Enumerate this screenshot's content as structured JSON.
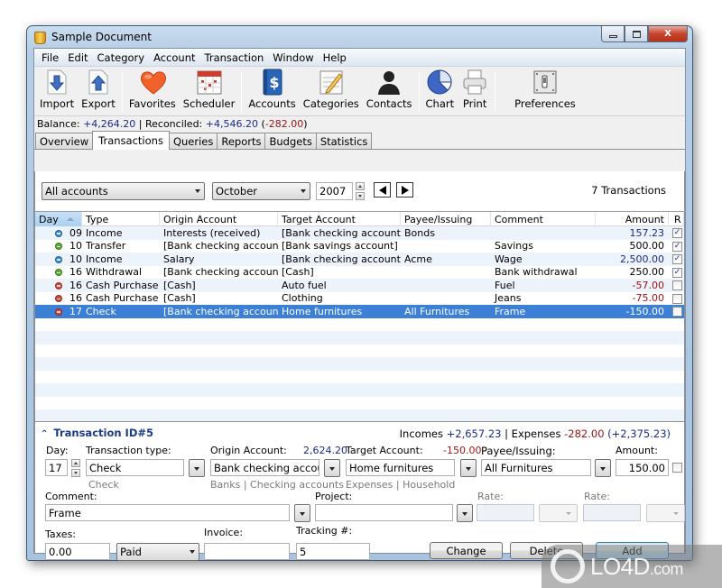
{
  "window": {
    "title": "Sample Document",
    "controls": {
      "minimize": "—",
      "maximize": "□",
      "close": "X"
    }
  },
  "menu": [
    "File",
    "Edit",
    "Category",
    "Account",
    "Transaction",
    "Window",
    "Help"
  ],
  "toolbar": {
    "groups": [
      [
        {
          "label": "Import",
          "icon": "import-icon"
        },
        {
          "label": "Export",
          "icon": "export-icon"
        }
      ],
      [
        {
          "label": "Favorites",
          "icon": "heart-icon"
        },
        {
          "label": "Scheduler",
          "icon": "calendar-icon"
        }
      ],
      [
        {
          "label": "Accounts",
          "icon": "accounts-book-icon"
        },
        {
          "label": "Categories",
          "icon": "categories-icon"
        },
        {
          "label": "Contacts",
          "icon": "contact-person-icon"
        }
      ],
      [
        {
          "label": "Chart",
          "icon": "pie-chart-icon"
        },
        {
          "label": "Print",
          "icon": "printer-icon"
        }
      ],
      [
        {
          "label": "Preferences",
          "icon": "preferences-switch-icon"
        }
      ]
    ]
  },
  "balance": {
    "balance_label": "Balance:",
    "balance_value": "+4,264.20",
    "separator": " | ",
    "reconciled_label": "Reconciled:",
    "reconciled_value": "+4,546.20",
    "difference": "-282.00"
  },
  "tabs": [
    {
      "label": "Overview",
      "active": false
    },
    {
      "label": "Transactions",
      "active": true
    },
    {
      "label": "Queries",
      "active": false
    },
    {
      "label": "Reports",
      "active": false
    },
    {
      "label": "Budgets",
      "active": false
    },
    {
      "label": "Statistics",
      "active": false
    }
  ],
  "filters": {
    "account": "All accounts",
    "month": "October",
    "year": "2007",
    "count": "7 Transactions"
  },
  "table": {
    "columns": [
      "Day",
      "Type",
      "Origin Account",
      "Target Account",
      "Payee/Issuing",
      "Comment",
      "Amount",
      "R"
    ],
    "sorted_column": "Day",
    "rows": [
      {
        "status": "blue",
        "day": "09",
        "type": "Income",
        "origin": "Interests (received)",
        "target": "[Bank checking account]",
        "payee": "Bonds",
        "comment": "",
        "amount": "157.23",
        "amount_color": "blue",
        "reconciled": true,
        "selected": false
      },
      {
        "status": "green",
        "day": "10",
        "type": "Transfer",
        "origin": "[Bank checking account]",
        "target": "[Bank savings account]",
        "payee": "",
        "comment": "Savings",
        "amount": "500.00",
        "amount_color": "black",
        "reconciled": true,
        "selected": false
      },
      {
        "status": "blue",
        "day": "10",
        "type": "Income",
        "origin": "Salary",
        "target": "[Bank checking account]",
        "payee": "Acme",
        "comment": "Wage",
        "amount": "2,500.00",
        "amount_color": "blue",
        "reconciled": true,
        "selected": false
      },
      {
        "status": "green",
        "day": "16",
        "type": "Withdrawal",
        "origin": "[Bank checking account]",
        "target": "[Cash]",
        "payee": "",
        "comment": "Bank withdrawal",
        "amount": "250.00",
        "amount_color": "black",
        "reconciled": true,
        "selected": false
      },
      {
        "status": "red",
        "day": "16",
        "type": "Cash Purchase",
        "origin": "[Cash]",
        "target": "Auto fuel",
        "payee": "",
        "comment": "Fuel",
        "amount": "-57.00",
        "amount_color": "red",
        "reconciled": false,
        "selected": false
      },
      {
        "status": "red",
        "day": "16",
        "type": "Cash Purchase",
        "origin": "[Cash]",
        "target": "Clothing",
        "payee": "",
        "comment": "Jeans",
        "amount": "-75.00",
        "amount_color": "red",
        "reconciled": false,
        "selected": false
      },
      {
        "status": "red",
        "day": "17",
        "type": "Check",
        "origin": "[Bank checking account]",
        "target": "Home furnitures",
        "payee": "All Furnitures",
        "comment": "Frame",
        "amount": "-150.00",
        "amount_color": "red",
        "reconciled": false,
        "selected": true
      }
    ]
  },
  "detail": {
    "title": "Transaction ID#5",
    "summary": {
      "incomes_label": "Incomes",
      "incomes": "+2,657.23",
      "sep": " | ",
      "expenses_label": "Expenses",
      "expenses": "-282.00",
      "net": "(+2,375.23)"
    },
    "day_label": "Day:",
    "day": "17",
    "type_label": "Transaction type:",
    "type": "Check",
    "type_hint": "Check",
    "origin_label": "Origin Account:",
    "origin_balance": "2,624.20",
    "origin": "Bank checking account",
    "origin_hint": "Banks | Checking accounts",
    "target_label": "Target Account:",
    "target_balance": "-150.00",
    "target": "Home furnitures",
    "target_hint": "Expenses | Household",
    "payee_label": "Payee/Issuing:",
    "payee": "All Furnitures",
    "amount_label": "Amount:",
    "amount": "150.00",
    "comment_label": "Comment:",
    "comment": "Frame",
    "project_label": "Project:",
    "project": "",
    "rate1_label": "Rate:",
    "rate2_label": "Rate:",
    "taxes_label": "Taxes:",
    "taxes": "0.00",
    "tax_status": "Paid",
    "invoice_label": "Invoice:",
    "invoice": "",
    "tracking_label": "Tracking #:",
    "tracking": "5",
    "buttons": {
      "change": "Change",
      "delete": "Delete",
      "add": "Add"
    }
  },
  "colors": {
    "status_blue": "#3b8fd6",
    "status_green": "#5cb030",
    "status_red": "#d8463a",
    "amount_blue": "#1a2a8a",
    "amount_red": "#9b1010",
    "selection": "#3c7fd6"
  },
  "watermark": {
    "text": "LO4D",
    "suffix": ".com"
  }
}
